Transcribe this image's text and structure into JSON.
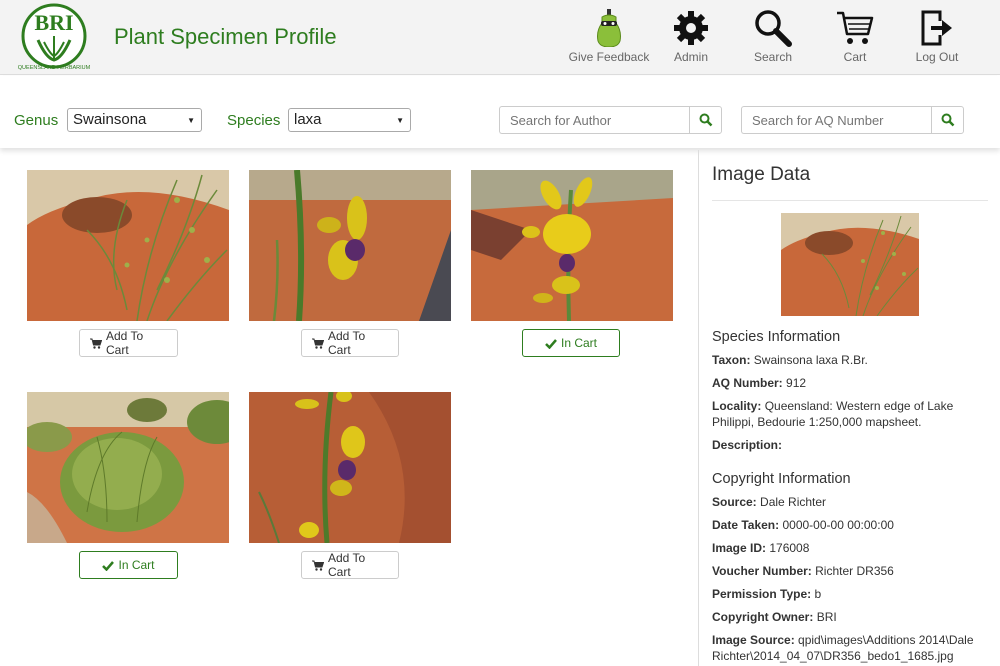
{
  "header": {
    "logo_text": "BRI",
    "logo_subtext": "QUEENSLAND HERBARIUM",
    "title": "Plant Specimen Profile",
    "nav": [
      {
        "label": "Give Feedback",
        "icon": "feedback-icon"
      },
      {
        "label": "Admin",
        "icon": "gear-icon"
      },
      {
        "label": "Search",
        "icon": "search-icon"
      },
      {
        "label": "Cart",
        "icon": "cart-icon"
      },
      {
        "label": "Log Out",
        "icon": "logout-icon"
      }
    ]
  },
  "filters": {
    "genus_label": "Genus",
    "genus_value": "Swainsona",
    "species_label": "Species",
    "species_value": "laxa",
    "author_placeholder": "Search for Author",
    "aq_placeholder": "Search for AQ Number"
  },
  "gallery": {
    "tiles": [
      {
        "button": "Add To Cart",
        "in_cart": false
      },
      {
        "button": "Add To Cart",
        "in_cart": false
      },
      {
        "button": "In Cart",
        "in_cart": true
      },
      {
        "button": "In Cart",
        "in_cart": true
      },
      {
        "button": "Add To Cart",
        "in_cart": false
      }
    ]
  },
  "sidebar": {
    "title": "Image Data",
    "species_heading": "Species Information",
    "species": [
      {
        "key": "Taxon:",
        "value": "Swainsona laxa R.Br."
      },
      {
        "key": "AQ Number:",
        "value": "912"
      },
      {
        "key": "Locality:",
        "value": "Queensland: Western edge of Lake Philippi, Bedourie 1:250,000 mapsheet."
      },
      {
        "key": "Description:",
        "value": ""
      }
    ],
    "copyright_heading": "Copyright Information",
    "copyright": [
      {
        "key": "Source:",
        "value": "Dale Richter"
      },
      {
        "key": "Date Taken:",
        "value": "0000-00-00 00:00:00"
      },
      {
        "key": "Image ID:",
        "value": "176008"
      },
      {
        "key": "Voucher Number:",
        "value": "Richter DR356"
      },
      {
        "key": "Permission Type:",
        "value": "b"
      },
      {
        "key": "Copyright Owner:",
        "value": "BRI"
      },
      {
        "key": "Image Source:",
        "value": "qpid\\images\\Additions 2014\\Dale Richter\\2014_04_07\\DR356_bedo1_1685.jpg"
      }
    ]
  },
  "colors": {
    "brand_green": "#2e7d1f",
    "header_bg": "#f3f3f3",
    "sand": "#c8683a"
  }
}
